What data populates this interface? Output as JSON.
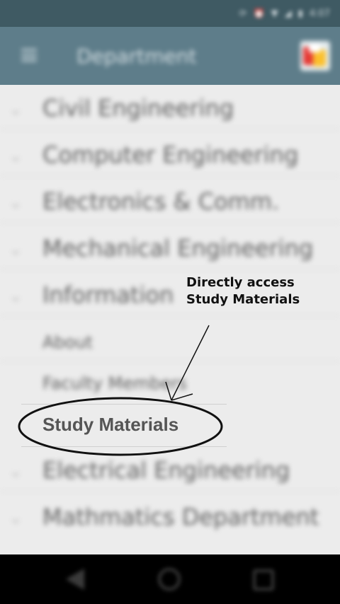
{
  "status_bar": {
    "icons": [
      "sync-icon",
      "alarm-icon",
      "signal-icon",
      "wifi-icon",
      "battery-icon"
    ],
    "time": "4:07"
  },
  "app_bar": {
    "title": "Department",
    "menu_icon": "menu-icon",
    "logo_icon": "app-logo-icon",
    "color": "#5e7d8a"
  },
  "drawer": {
    "items": [
      {
        "label": "Civil Engineering",
        "type": "group"
      },
      {
        "label": "Computer Engineering",
        "type": "group"
      },
      {
        "label": "Electronics & Comm.",
        "type": "group"
      },
      {
        "label": "Mechanical Engineering",
        "type": "group"
      },
      {
        "label": "Information",
        "type": "group"
      },
      {
        "label": "About",
        "type": "child"
      },
      {
        "label": "Faculty Members",
        "type": "child"
      },
      {
        "label": "Study Materials",
        "type": "child",
        "highlighted": true
      },
      {
        "label": "Electrical Engineering",
        "type": "group"
      },
      {
        "label": "Mathmatics Department",
        "type": "group"
      }
    ]
  },
  "annotation": {
    "line1": "Directly access",
    "line2": "Study Materials"
  },
  "nav_bar": {
    "back_icon": "back-icon",
    "home_icon": "home-icon",
    "recents_icon": "recents-icon"
  }
}
